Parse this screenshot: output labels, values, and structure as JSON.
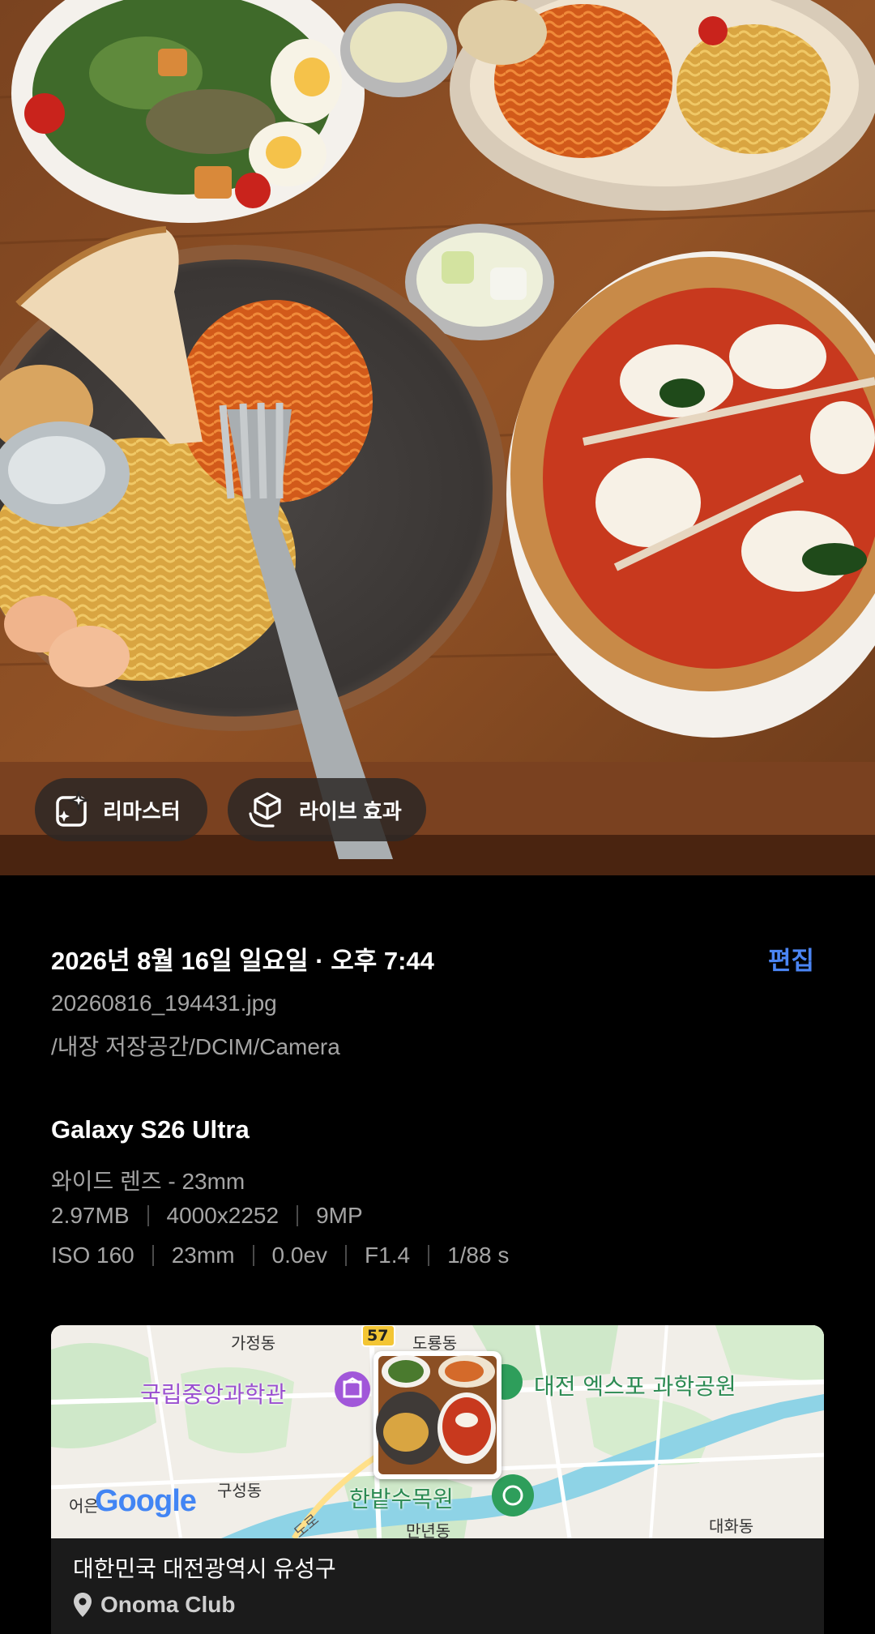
{
  "photo": {
    "description_icon": "photo-food-table",
    "chips": [
      {
        "label": "리마스터",
        "icon": "sparkle-frame-icon"
      },
      {
        "label": "라이브 효과",
        "icon": "cube-hand-icon"
      }
    ]
  },
  "info": {
    "datetime": "2026년 8월 16일 일요일 · 오후 7:44",
    "edit_label": "편집",
    "filename": "20260816_194431.jpg",
    "path": "/내장 저장공간/DCIM/Camera",
    "device": "Galaxy S26 Ultra",
    "lens": "와이드 렌즈 - 23mm",
    "file_meta": [
      "2.97MB",
      "4000x2252",
      "9MP"
    ],
    "exif": [
      "ISO 160",
      "23mm",
      "0.0ev",
      "F1.4",
      "1/88 s"
    ]
  },
  "map": {
    "labels": {
      "gajeong": "가정동",
      "route": "57",
      "doryong": "도룡동",
      "museum": "국립중앙과학관",
      "expo": "대전 엑스포 과학공원",
      "guseong": "구성동",
      "arboretum": "한밭수목원",
      "eoeun": "어은",
      "road": "도로",
      "mannyeon": "만년동",
      "daehwa": "대화동",
      "google": "Google"
    },
    "address": "대한민국 대전광역시 유성구",
    "place": "Onoma Club",
    "colors": {
      "museum_pin": "#a157d9",
      "park_pin": "#2e9e5b",
      "river": "#8ed3e6"
    }
  }
}
